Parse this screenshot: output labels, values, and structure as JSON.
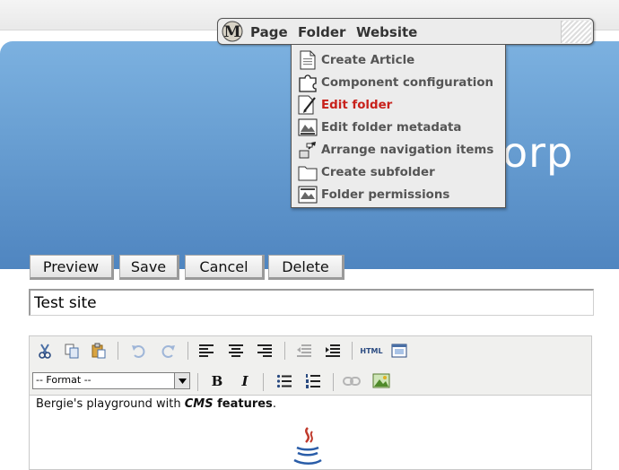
{
  "menubar": {
    "logo_letter": "M",
    "items": [
      {
        "label": "Page"
      },
      {
        "label": "Folder"
      },
      {
        "label": "Website"
      }
    ]
  },
  "dropdown": {
    "items": [
      {
        "label": "Create Article",
        "icon": "document-icon"
      },
      {
        "label": "Component configuration",
        "icon": "puzzle-icon"
      },
      {
        "label": "Edit folder",
        "icon": "edit-document-icon",
        "active": true
      },
      {
        "label": "Edit folder metadata",
        "icon": "image-properties-icon"
      },
      {
        "label": "Arrange navigation items",
        "icon": "arrange-icon"
      },
      {
        "label": "Create subfolder",
        "icon": "folder-icon"
      },
      {
        "label": "Folder permissions",
        "icon": "permissions-icon"
      }
    ],
    "active_color": "#c8211b"
  },
  "banner": {
    "brand_fragment": "orp",
    "color_top": "#7cb1e0",
    "color_bottom": "#4f85c0"
  },
  "buttons": {
    "preview": "Preview",
    "save": "Save",
    "cancel": "Cancel",
    "delete": "Delete"
  },
  "title_field": {
    "value": "Test site"
  },
  "editor": {
    "format_select": "-- Format --",
    "toolbar_icons": [
      "cut-icon",
      "copy-icon",
      "paste-icon",
      "undo-icon",
      "redo-icon",
      "align-left-icon",
      "align-center-icon",
      "align-right-icon",
      "outdent-icon",
      "indent-icon",
      "html-icon",
      "fullscreen-icon",
      "bold-icon",
      "italic-icon",
      "bullet-list-icon",
      "numbered-list-icon",
      "link-icon",
      "image-icon"
    ],
    "html_label": "HTML",
    "bold_label": "B",
    "italic_label": "I",
    "content": {
      "prefix": "Bergie's playground with ",
      "em": "CMS",
      "strong": " features",
      "suffix": "."
    }
  }
}
